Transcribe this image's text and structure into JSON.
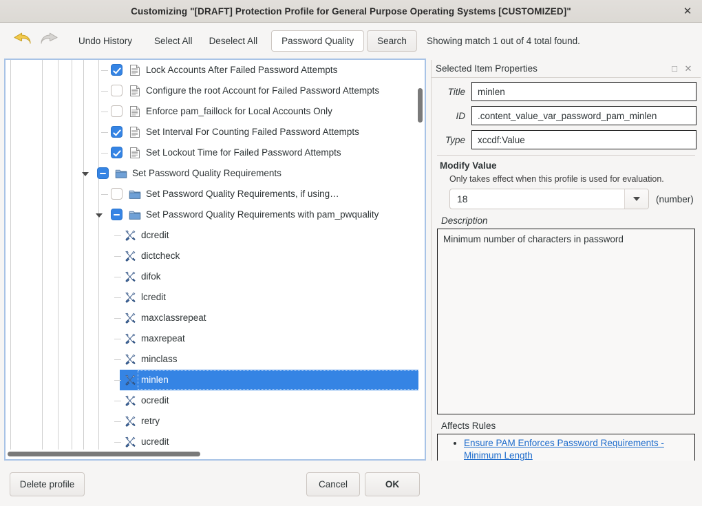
{
  "window": {
    "title": "Customizing \"[DRAFT] Protection Profile for General Purpose Operating Systems [CUSTOMIZED]\"",
    "close_glyph": "✕"
  },
  "toolbar": {
    "undo_icon": "undo-arrow-icon",
    "redo_icon": "redo-arrow-icon",
    "undo_history_label": "Undo History",
    "select_all_label": "Select All",
    "deselect_all_label": "Deselect All",
    "search_value": "Password Quality",
    "search_button_label": "Search",
    "status_text": "Showing match 1 out of 4 total found."
  },
  "tree": {
    "rows": [
      {
        "label": "Lock Accounts After Failed Password Attempts",
        "depth": 5,
        "check": "on",
        "icon": "document-icon",
        "expander": "none",
        "selected": false
      },
      {
        "label": "Configure the root Account for Failed Password Attempts",
        "depth": 5,
        "check": "off",
        "icon": "document-icon",
        "expander": "none",
        "selected": false
      },
      {
        "label": "Enforce pam_faillock for Local Accounts Only",
        "depth": 5,
        "check": "off",
        "icon": "document-icon",
        "expander": "none",
        "selected": false
      },
      {
        "label": "Set Interval For Counting Failed Password Attempts",
        "depth": 5,
        "check": "on",
        "icon": "document-icon",
        "expander": "none",
        "selected": false
      },
      {
        "label": "Set Lockout Time for Failed Password Attempts",
        "depth": 5,
        "check": "on",
        "icon": "document-icon",
        "expander": "none",
        "selected": false
      },
      {
        "label": "Set Password Quality Requirements",
        "depth": 4,
        "check": "mixed",
        "icon": "folder-icon",
        "expander": "expanded",
        "selected": false
      },
      {
        "label": "Set Password Quality Requirements, if using…",
        "depth": 5,
        "check": "off",
        "icon": "folder-icon",
        "expander": "none",
        "selected": false
      },
      {
        "label": "Set Password Quality Requirements with pam_pwquality",
        "depth": 5,
        "check": "mixed",
        "icon": "folder-icon",
        "expander": "expanded",
        "selected": false
      },
      {
        "label": "dcredit",
        "depth": 6,
        "check": "none",
        "icon": "tools-icon",
        "expander": "none",
        "selected": false
      },
      {
        "label": "dictcheck",
        "depth": 6,
        "check": "none",
        "icon": "tools-icon",
        "expander": "none",
        "selected": false
      },
      {
        "label": "difok",
        "depth": 6,
        "check": "none",
        "icon": "tools-icon",
        "expander": "none",
        "selected": false
      },
      {
        "label": "lcredit",
        "depth": 6,
        "check": "none",
        "icon": "tools-icon",
        "expander": "none",
        "selected": false
      },
      {
        "label": "maxclassrepeat",
        "depth": 6,
        "check": "none",
        "icon": "tools-icon",
        "expander": "none",
        "selected": false
      },
      {
        "label": "maxrepeat",
        "depth": 6,
        "check": "none",
        "icon": "tools-icon",
        "expander": "none",
        "selected": false
      },
      {
        "label": "minclass",
        "depth": 6,
        "check": "none",
        "icon": "tools-icon",
        "expander": "none",
        "selected": false
      },
      {
        "label": "minlen",
        "depth": 6,
        "check": "none",
        "icon": "tools-icon",
        "expander": "none",
        "selected": true
      },
      {
        "label": "ocredit",
        "depth": 6,
        "check": "none",
        "icon": "tools-icon",
        "expander": "none",
        "selected": false
      },
      {
        "label": "retry",
        "depth": 6,
        "check": "none",
        "icon": "tools-icon",
        "expander": "none",
        "selected": false
      },
      {
        "label": "ucredit",
        "depth": 6,
        "check": "none",
        "icon": "tools-icon",
        "expander": "none",
        "selected": false
      }
    ]
  },
  "properties": {
    "panel_title": "Selected Item Properties",
    "float_glyph": "□",
    "close_glyph": "✕",
    "title_label": "Title",
    "title_value": "minlen",
    "id_label": "ID",
    "id_value": ".content_value_var_password_pam_minlen",
    "type_label": "Type",
    "type_value": "xccdf:Value",
    "modify_value_label": "Modify Value",
    "modify_value_note": "Only takes effect when this profile is used for evaluation.",
    "value": "18",
    "value_unit": "(number)",
    "description_label": "Description",
    "description_text": "Minimum number of characters in password",
    "affects_rules_label": "Affects Rules",
    "affects_rules": [
      "Ensure PAM Enforces Password Requirements - Minimum Length"
    ]
  },
  "footer": {
    "delete_profile_label": "Delete profile",
    "cancel_label": "Cancel",
    "ok_label": "OK"
  },
  "colors": {
    "selection_blue": "#3584e4",
    "link_blue": "#1b6acb",
    "titlebar": "#ded ب"
  }
}
